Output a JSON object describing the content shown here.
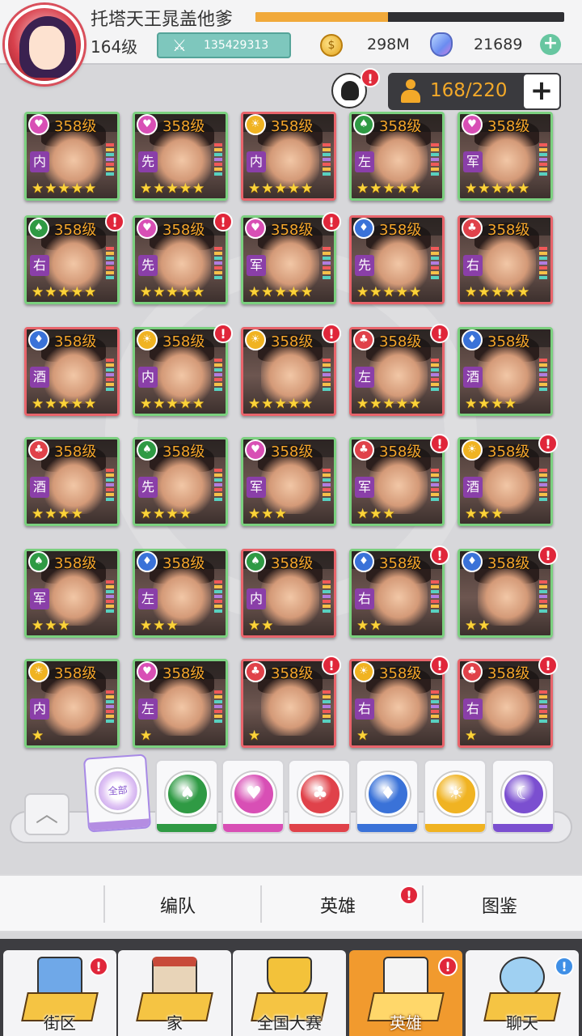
{
  "player": {
    "name": "托塔天王晁盖他爹",
    "level": "164级",
    "power": "135429313",
    "exp_fraction": 0.43
  },
  "currency": {
    "coins": "298M",
    "gems": "21689"
  },
  "roster": {
    "capacity": "168/220"
  },
  "heroes": [
    {
      "level": "358级",
      "suit": "pink",
      "class": "内",
      "stars": 5,
      "frame": "green",
      "alert": false
    },
    {
      "level": "358级",
      "suit": "pink",
      "class": "先",
      "stars": 5,
      "frame": "green",
      "alert": false
    },
    {
      "level": "358级",
      "suit": "gold",
      "class": "内",
      "stars": 5,
      "frame": "red",
      "alert": false
    },
    {
      "level": "358级",
      "suit": "green",
      "class": "左",
      "stars": 5,
      "frame": "green",
      "alert": false
    },
    {
      "level": "358级",
      "suit": "pink",
      "class": "军",
      "stars": 5,
      "frame": "green",
      "alert": false
    },
    {
      "level": "358级",
      "suit": "green",
      "class": "右",
      "stars": 5,
      "frame": "green",
      "alert": true
    },
    {
      "level": "358级",
      "suit": "pink",
      "class": "先",
      "stars": 5,
      "frame": "green",
      "alert": true
    },
    {
      "level": "358级",
      "suit": "pink",
      "class": "军",
      "stars": 5,
      "frame": "green",
      "alert": true
    },
    {
      "level": "358级",
      "suit": "blue",
      "class": "先",
      "stars": 5,
      "frame": "red",
      "alert": false
    },
    {
      "level": "358级",
      "suit": "red",
      "class": "右",
      "stars": 5,
      "frame": "red",
      "alert": false
    },
    {
      "level": "358级",
      "suit": "blue",
      "class": "酒",
      "stars": 5,
      "frame": "red",
      "alert": false
    },
    {
      "level": "358级",
      "suit": "gold",
      "class": "内",
      "stars": 5,
      "frame": "green",
      "alert": true
    },
    {
      "level": "358级",
      "suit": "gold",
      "class": "",
      "stars": 5,
      "frame": "red",
      "alert": true
    },
    {
      "level": "358级",
      "suit": "red",
      "class": "左",
      "stars": 5,
      "frame": "red",
      "alert": true
    },
    {
      "level": "358级",
      "suit": "blue",
      "class": "酒",
      "stars": 4,
      "frame": "green",
      "alert": false
    },
    {
      "level": "358级",
      "suit": "red",
      "class": "酒",
      "stars": 4,
      "frame": "green",
      "alert": false
    },
    {
      "level": "358级",
      "suit": "green",
      "class": "先",
      "stars": 4,
      "frame": "green",
      "alert": false
    },
    {
      "level": "358级",
      "suit": "pink",
      "class": "军",
      "stars": 3,
      "frame": "green",
      "alert": false
    },
    {
      "level": "358级",
      "suit": "red",
      "class": "军",
      "stars": 3,
      "frame": "green",
      "alert": true
    },
    {
      "level": "358级",
      "suit": "gold",
      "class": "酒",
      "stars": 3,
      "frame": "green",
      "alert": true
    },
    {
      "level": "358级",
      "suit": "green",
      "class": "军",
      "stars": 3,
      "frame": "green",
      "alert": false
    },
    {
      "level": "358级",
      "suit": "blue",
      "class": "左",
      "stars": 3,
      "frame": "green",
      "alert": false
    },
    {
      "level": "358级",
      "suit": "green",
      "class": "内",
      "stars": 2,
      "frame": "red",
      "alert": false
    },
    {
      "level": "358级",
      "suit": "blue",
      "class": "右",
      "stars": 2,
      "frame": "green",
      "alert": true
    },
    {
      "level": "358级",
      "suit": "blue",
      "class": "",
      "stars": 2,
      "frame": "green",
      "alert": true
    },
    {
      "level": "358级",
      "suit": "gold",
      "class": "内",
      "stars": 1,
      "frame": "green",
      "alert": false
    },
    {
      "level": "358级",
      "suit": "pink",
      "class": "左",
      "stars": 1,
      "frame": "green",
      "alert": false
    },
    {
      "level": "358级",
      "suit": "red",
      "class": "",
      "stars": 1,
      "frame": "red",
      "alert": true
    },
    {
      "level": "358级",
      "suit": "gold",
      "class": "右",
      "stars": 1,
      "frame": "red",
      "alert": true
    },
    {
      "level": "358级",
      "suit": "red",
      "class": "右",
      "stars": 1,
      "frame": "red",
      "alert": true
    }
  ],
  "filters": [
    {
      "name": "all",
      "label": "全部",
      "color": "#b48de2"
    },
    {
      "name": "spade",
      "label": "♠",
      "color": "#2f9a44"
    },
    {
      "name": "heart",
      "label": "♥",
      "color": "#d84fb5"
    },
    {
      "name": "club",
      "label": "♣",
      "color": "#e0424a"
    },
    {
      "name": "diamond",
      "label": "♦",
      "color": "#3a72d8"
    },
    {
      "name": "sun",
      "label": "☀",
      "color": "#f0b322"
    },
    {
      "name": "moon",
      "label": "☾",
      "color": "#7b4fd0"
    }
  ],
  "subtabs": {
    "formation": "编队",
    "heroes": "英雄",
    "codex": "图鉴"
  },
  "nav": {
    "street": "街区",
    "home": "家",
    "tournament": "全国大赛",
    "heroes": "英雄",
    "chat": "聊天"
  },
  "colors": {
    "accent_orange": "#f19a2e",
    "alert_red": "#e0263a",
    "info_blue": "#3f8fe6"
  }
}
